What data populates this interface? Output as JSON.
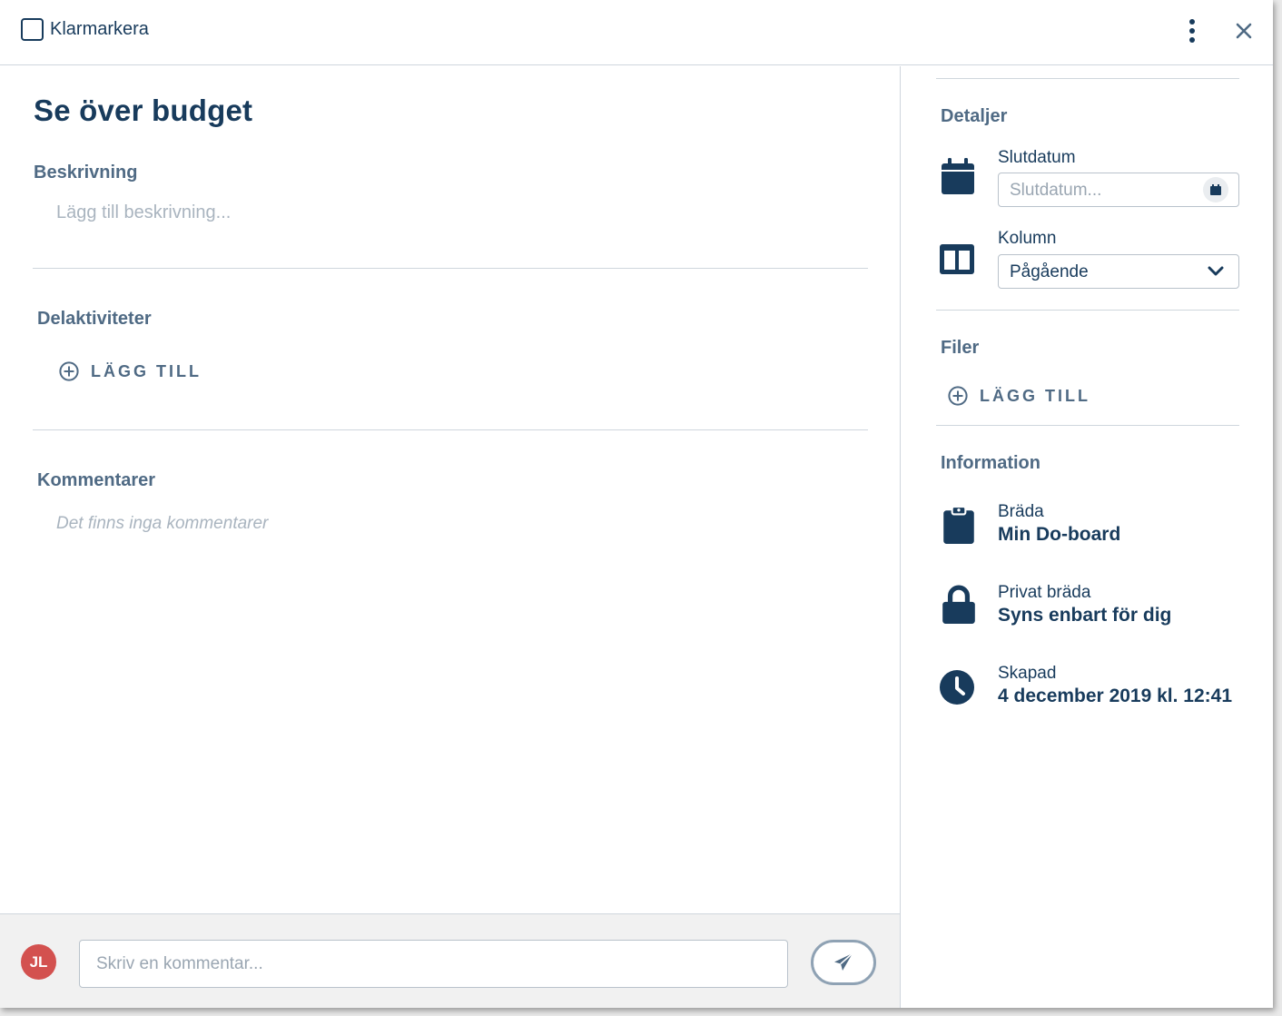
{
  "header": {
    "mark_done_label": "Klarmarkera"
  },
  "task": {
    "title": "Se över budget",
    "description_label": "Beskrivning",
    "description_placeholder": "Lägg till beskrivning...",
    "subtasks_label": "Delaktiviteter",
    "subtasks_add_label": "LÄGG TILL",
    "comments_label": "Kommentarer",
    "comments_empty": "Det finns inga kommentarer"
  },
  "comment_bar": {
    "avatar_initials": "JL",
    "input_placeholder": "Skriv en kommentar..."
  },
  "details": {
    "heading": "Detaljer",
    "due_date_label": "Slutdatum",
    "due_date_placeholder": "Slutdatum...",
    "column_label": "Kolumn",
    "column_value": "Pågående"
  },
  "files": {
    "heading": "Filer",
    "add_label": "LÄGG TILL"
  },
  "information": {
    "heading": "Information",
    "board_label": "Bräda",
    "board_value": "Min Do-board",
    "privacy_label": "Privat bräda",
    "privacy_value": "Syns enbart för dig",
    "created_label": "Skapad",
    "created_value": "4 december 2019 kl. 12:41"
  },
  "colors": {
    "primary": "#183b5c",
    "muted": "#4f6a84",
    "placeholder": "#a9b4bf",
    "avatar": "#d3514f"
  },
  "icons": [
    "more-vertical-icon",
    "close-icon",
    "add-circle-icon",
    "calendar-icon",
    "columns-icon",
    "chevron-down-icon",
    "clipboard-icon",
    "lock-icon",
    "clock-icon",
    "send-icon"
  ]
}
